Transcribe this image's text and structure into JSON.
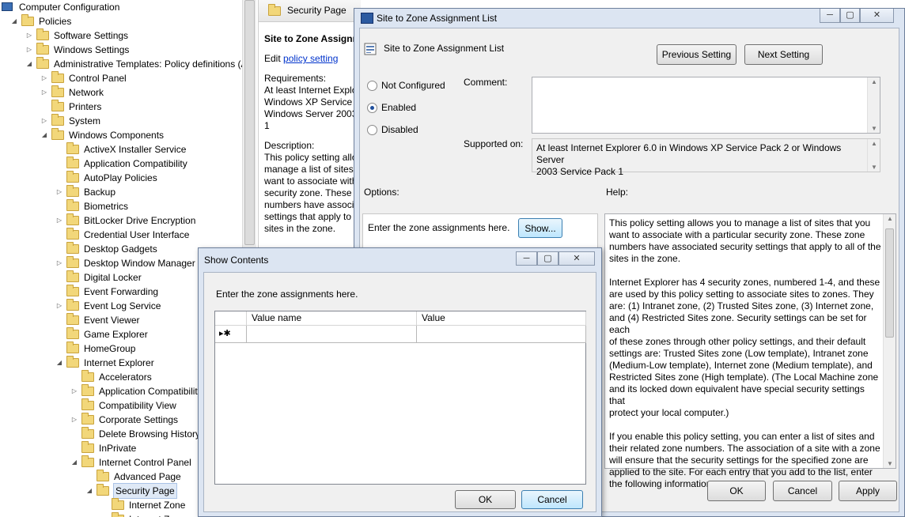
{
  "tree": {
    "items": [
      {
        "label": "Computer Configuration",
        "indent": 0,
        "twisty": "",
        "icon": "computer"
      },
      {
        "label": "Policies",
        "indent": 1,
        "twisty": "open",
        "icon": "folder"
      },
      {
        "label": "Software Settings",
        "indent": 2,
        "twisty": "closed",
        "icon": "folder"
      },
      {
        "label": "Windows Settings",
        "indent": 2,
        "twisty": "closed",
        "icon": "folder"
      },
      {
        "label": "Administrative Templates: Policy definitions (A",
        "indent": 2,
        "twisty": "open",
        "icon": "folder"
      },
      {
        "label": "Control Panel",
        "indent": 3,
        "twisty": "closed",
        "icon": "folder"
      },
      {
        "label": "Network",
        "indent": 3,
        "twisty": "closed",
        "icon": "folder"
      },
      {
        "label": "Printers",
        "indent": 3,
        "twisty": "",
        "icon": "folder"
      },
      {
        "label": "System",
        "indent": 3,
        "twisty": "closed",
        "icon": "folder"
      },
      {
        "label": "Windows Components",
        "indent": 3,
        "twisty": "open",
        "icon": "folder"
      },
      {
        "label": "ActiveX Installer Service",
        "indent": 4,
        "twisty": "",
        "icon": "folder"
      },
      {
        "label": "Application Compatibility",
        "indent": 4,
        "twisty": "",
        "icon": "folder"
      },
      {
        "label": "AutoPlay Policies",
        "indent": 4,
        "twisty": "",
        "icon": "folder"
      },
      {
        "label": "Backup",
        "indent": 4,
        "twisty": "closed",
        "icon": "folder"
      },
      {
        "label": "Biometrics",
        "indent": 4,
        "twisty": "",
        "icon": "folder"
      },
      {
        "label": "BitLocker Drive Encryption",
        "indent": 4,
        "twisty": "closed",
        "icon": "folder"
      },
      {
        "label": "Credential User Interface",
        "indent": 4,
        "twisty": "",
        "icon": "folder"
      },
      {
        "label": "Desktop Gadgets",
        "indent": 4,
        "twisty": "",
        "icon": "folder"
      },
      {
        "label": "Desktop Window Manager",
        "indent": 4,
        "twisty": "closed",
        "icon": "folder"
      },
      {
        "label": "Digital Locker",
        "indent": 4,
        "twisty": "",
        "icon": "folder"
      },
      {
        "label": "Event Forwarding",
        "indent": 4,
        "twisty": "",
        "icon": "folder"
      },
      {
        "label": "Event Log Service",
        "indent": 4,
        "twisty": "closed",
        "icon": "folder"
      },
      {
        "label": "Event Viewer",
        "indent": 4,
        "twisty": "",
        "icon": "folder"
      },
      {
        "label": "Game Explorer",
        "indent": 4,
        "twisty": "",
        "icon": "folder"
      },
      {
        "label": "HomeGroup",
        "indent": 4,
        "twisty": "",
        "icon": "folder"
      },
      {
        "label": "Internet Explorer",
        "indent": 4,
        "twisty": "open",
        "icon": "folder"
      },
      {
        "label": "Accelerators",
        "indent": 5,
        "twisty": "",
        "icon": "folder"
      },
      {
        "label": "Application Compatibility",
        "indent": 5,
        "twisty": "closed",
        "icon": "folder"
      },
      {
        "label": "Compatibility View",
        "indent": 5,
        "twisty": "",
        "icon": "folder"
      },
      {
        "label": "Corporate Settings",
        "indent": 5,
        "twisty": "closed",
        "icon": "folder"
      },
      {
        "label": "Delete Browsing History",
        "indent": 5,
        "twisty": "",
        "icon": "folder"
      },
      {
        "label": "InPrivate",
        "indent": 5,
        "twisty": "",
        "icon": "folder"
      },
      {
        "label": "Internet Control Panel",
        "indent": 5,
        "twisty": "open",
        "icon": "folder"
      },
      {
        "label": "Advanced Page",
        "indent": 6,
        "twisty": "",
        "icon": "folder"
      },
      {
        "label": "Security Page",
        "indent": 6,
        "twisty": "open",
        "icon": "folder",
        "selected": true
      },
      {
        "label": "Internet Zone",
        "indent": 7,
        "twisty": "",
        "icon": "folder"
      },
      {
        "label": "Intranet Zone",
        "indent": 7,
        "twisty": "",
        "icon": "folder"
      }
    ]
  },
  "explain": {
    "tab_label": "Security Page",
    "heading": "Site to Zone Assignm",
    "edit_prefix": "Edit ",
    "edit_link": "policy setting",
    "requirements_label": "Requirements:",
    "requirements_lines": [
      "At least Internet Explo",
      "Windows XP Service P",
      "Windows Server 2003",
      "1"
    ],
    "description_label": "Description:",
    "description_lines": [
      "This policy setting allo",
      "manage a list of sites",
      "want to associate with",
      "security zone. These z",
      "numbers have associa",
      "settings that apply to",
      "sites in the zone."
    ]
  },
  "dialog": {
    "title": "Site to Zone Assignment List",
    "header_title": "Site to Zone Assignment List",
    "prev_button": "Previous Setting",
    "next_button": "Next Setting",
    "radio_not_configured": "Not Configured",
    "radio_enabled": "Enabled",
    "radio_disabled": "Disabled",
    "selected_radio": "Enabled",
    "comment_label": "Comment:",
    "supported_label": "Supported on:",
    "supported_lines": [
      "At least Internet Explorer 6.0 in Windows XP Service Pack 2 or Windows Server",
      "2003 Service Pack 1"
    ],
    "options_label": "Options:",
    "help_label": "Help:",
    "zone_prompt": "Enter the zone assignments here.",
    "show_button": "Show...",
    "help_paragraphs": [
      [
        "This policy setting allows you to manage a list of sites that you",
        "want to associate with a particular security zone. These zone",
        "numbers have associated security settings that apply to all of the",
        "sites in the zone."
      ],
      [
        "Internet Explorer has 4 security zones, numbered 1-4, and these",
        "are used by this policy setting to associate sites to zones. They",
        "are: (1) Intranet zone, (2) Trusted Sites zone, (3) Internet zone,",
        "and (4) Restricted Sites zone. Security settings can be set for each",
        "of these zones through other policy settings, and their default",
        "settings are: Trusted Sites zone (Low template), Intranet zone",
        "(Medium-Low template), Internet zone (Medium template), and",
        "Restricted Sites zone (High template). (The Local Machine zone",
        "and its locked down equivalent have special security settings that",
        "protect your local computer.)"
      ],
      [
        "If you enable this policy setting, you can enter a list of sites and",
        "their related zone numbers. The association of a site with a zone",
        "will ensure that the security settings for the specified zone are",
        "applied to the site.  For each entry that you add to the list, enter",
        "the following information:"
      ]
    ],
    "ok_button": "OK",
    "cancel_button": "Cancel",
    "apply_button": "Apply"
  },
  "show_contents": {
    "title": "Show Contents",
    "prompt": "Enter the zone assignments here.",
    "columns": [
      "Value name",
      "Value"
    ],
    "new_row_marker": "▸✱",
    "ok_button": "OK",
    "cancel_button": "Cancel"
  }
}
